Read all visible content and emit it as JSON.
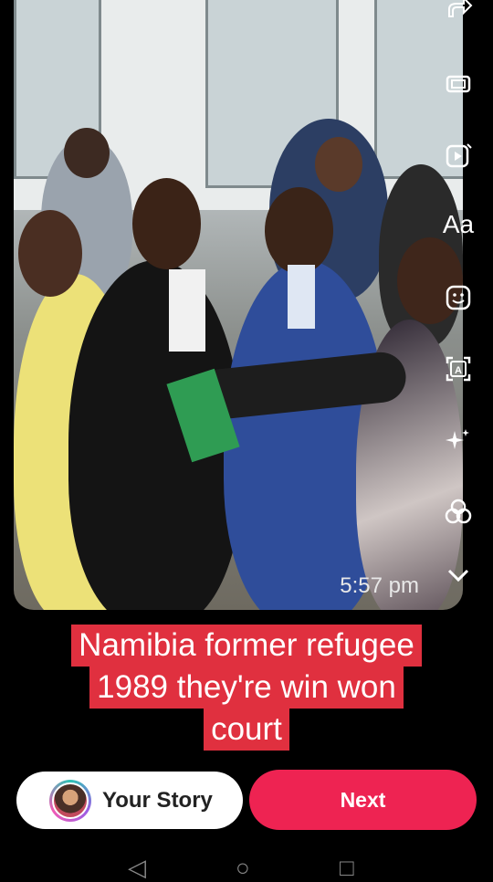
{
  "photo": {
    "timestamp": "5:57 pm"
  },
  "tools": [
    {
      "name": "share-icon"
    },
    {
      "name": "format-icon"
    },
    {
      "name": "media-icon"
    },
    {
      "name": "text-icon",
      "label": "Aa"
    },
    {
      "name": "sticker-icon"
    },
    {
      "name": "caption-icon"
    },
    {
      "name": "effects-icon"
    },
    {
      "name": "filters-icon"
    },
    {
      "name": "chevron-down-icon"
    }
  ],
  "caption": {
    "line1": "Namibia former refugee",
    "line2": "1989 they're win won",
    "line3": "court"
  },
  "actions": {
    "your_story": "Your Story",
    "next": "Next"
  },
  "colors": {
    "caption_bg": "#e0303f",
    "next_bg": "#ee2352"
  }
}
